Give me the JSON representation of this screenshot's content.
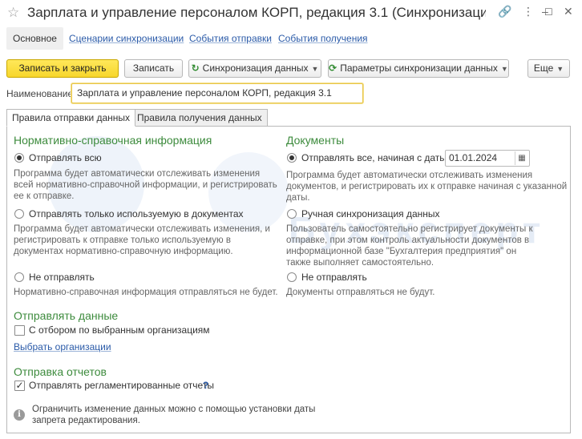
{
  "window": {
    "title": "Зарплата и управление персоналом КОРП, редакция 3.1 (Синхронизаци...",
    "controls": [
      "link-icon",
      "more-icon",
      "minimize-icon",
      "maximize-icon",
      "close-icon"
    ],
    "control_glyphs": [
      "🔗",
      "⋮",
      "–",
      "☐",
      "✕"
    ]
  },
  "nav_tabs": [
    {
      "label": "Основное",
      "active": true
    },
    {
      "label": "Сценарии синхронизации",
      "active": false
    },
    {
      "label": "События отправки",
      "active": false
    },
    {
      "label": "События получения",
      "active": false
    }
  ],
  "toolbar": {
    "write_close": "Записать и закрыть",
    "write": "Записать",
    "sync": "Синхронизация данных",
    "sync_params": "Параметры синхронизации данных",
    "more": "Еще"
  },
  "name_field": {
    "label": "Наименование:",
    "value": "Зарплата и управление персоналом КОРП, редакция 3.1"
  },
  "sub_tabs": [
    {
      "label": "Правила отправки данных",
      "active": true
    },
    {
      "label": "Правила получения данных",
      "active": false
    }
  ],
  "watermark": "Бухэксперт",
  "nsi": {
    "title": "Нормативно-справочная информация",
    "options": [
      {
        "label": "Отправлять всю",
        "checked": true,
        "desc": "Программа будет автоматически отслеживать изменения всей нормативно-справочной информации, и регистрировать ее к отправке."
      },
      {
        "label": "Отправлять только используемую в документах",
        "checked": false,
        "desc": "Программа будет автоматически отслеживать изменения, и регистрировать к отправке только используемую в документах нормативно-справочную информацию."
      },
      {
        "label": "Не отправлять",
        "checked": false,
        "desc": "Нормативно-справочная информация отправляться не будет."
      }
    ]
  },
  "docs": {
    "title": "Документы",
    "date_value": "01.01.2024",
    "options": [
      {
        "label": "Отправлять все, начиная с даты",
        "checked": true,
        "desc": "Программа будет автоматически отслеживать изменения документов, и регистрировать их к отправке начиная с указанной даты."
      },
      {
        "label": "Ручная синхронизация данных",
        "checked": false,
        "desc": "Пользователь самостоятельно регистрирует документы к отправке, при этом контроль актуальности документов в информационной базе \"Бухгалтерия предприятия\" он также выполняет самостоятельно."
      },
      {
        "label": "Не отправлять",
        "checked": false,
        "desc": "Документы отправляться не будут."
      }
    ]
  },
  "send_data": {
    "title": "Отправлять данные",
    "filter_label": "С отбором по выбранным организациям",
    "filter_checked": false,
    "select_link": "Выбрать организации"
  },
  "reports": {
    "title": "Отправка отчетов",
    "label": "Отправлять регламентированные отчеты",
    "checked": true,
    "help": "?"
  },
  "info": {
    "icon": "i",
    "text": "Ограничить изменение данных можно с помощью установки даты запрета редактирования."
  }
}
